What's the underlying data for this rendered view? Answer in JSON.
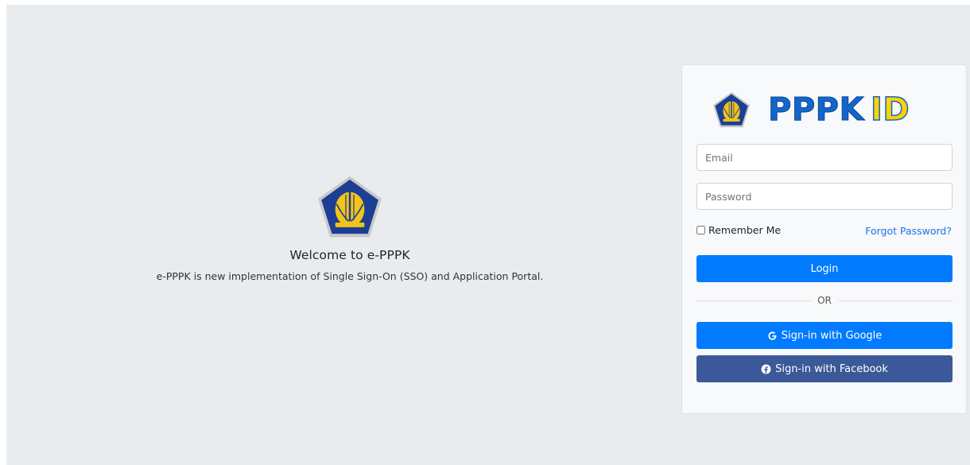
{
  "welcome": {
    "title": "Welcome to e-PPPK",
    "description": "e-PPPK is new implementation of Single Sign-On (SSO) and Application Portal."
  },
  "brand": {
    "name_part1": "PPPK",
    "name_part2": "ID"
  },
  "form": {
    "email_placeholder": "Email",
    "password_placeholder": "Password",
    "remember_label": "Remember Me",
    "forgot_label": "Forgot Password?",
    "login_label": "Login",
    "divider_label": "OR",
    "google_label": "Sign-in with Google",
    "facebook_label": "Sign-in with Facebook"
  },
  "colors": {
    "primary": "#007bff",
    "facebook": "#3b5998",
    "link": "#1a73e8",
    "background": "#e9ecef"
  }
}
